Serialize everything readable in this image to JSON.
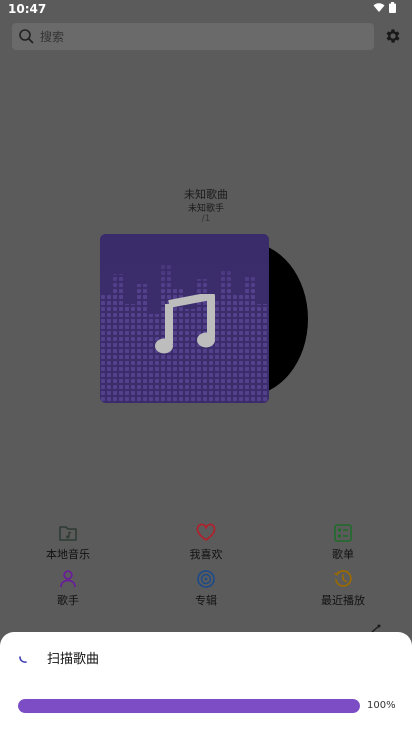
{
  "status_bar": {
    "time": "10:47"
  },
  "search": {
    "placeholder": "搜索"
  },
  "now_playing": {
    "title": "未知歌曲",
    "artist": "未知歌手",
    "index": "/1"
  },
  "menu": [
    {
      "label": "本地音乐",
      "icon": "folder-music-icon",
      "color": "#2f3b34"
    },
    {
      "label": "我喜欢",
      "icon": "heart-icon",
      "color": "#b2202b"
    },
    {
      "label": "歌单",
      "icon": "playlist-icon",
      "color": "#1f6b2a"
    },
    {
      "label": "歌手",
      "icon": "person-icon",
      "color": "#6a1a9a"
    },
    {
      "label": "专辑",
      "icon": "album-icon",
      "color": "#1a4a8a"
    },
    {
      "label": "最近播放",
      "icon": "history-icon",
      "color": "#9a6a00"
    }
  ],
  "scan_dialog": {
    "title": "扫描歌曲",
    "progress_label": "100%",
    "progress": 1.0,
    "accent": "#7c4dc4"
  }
}
